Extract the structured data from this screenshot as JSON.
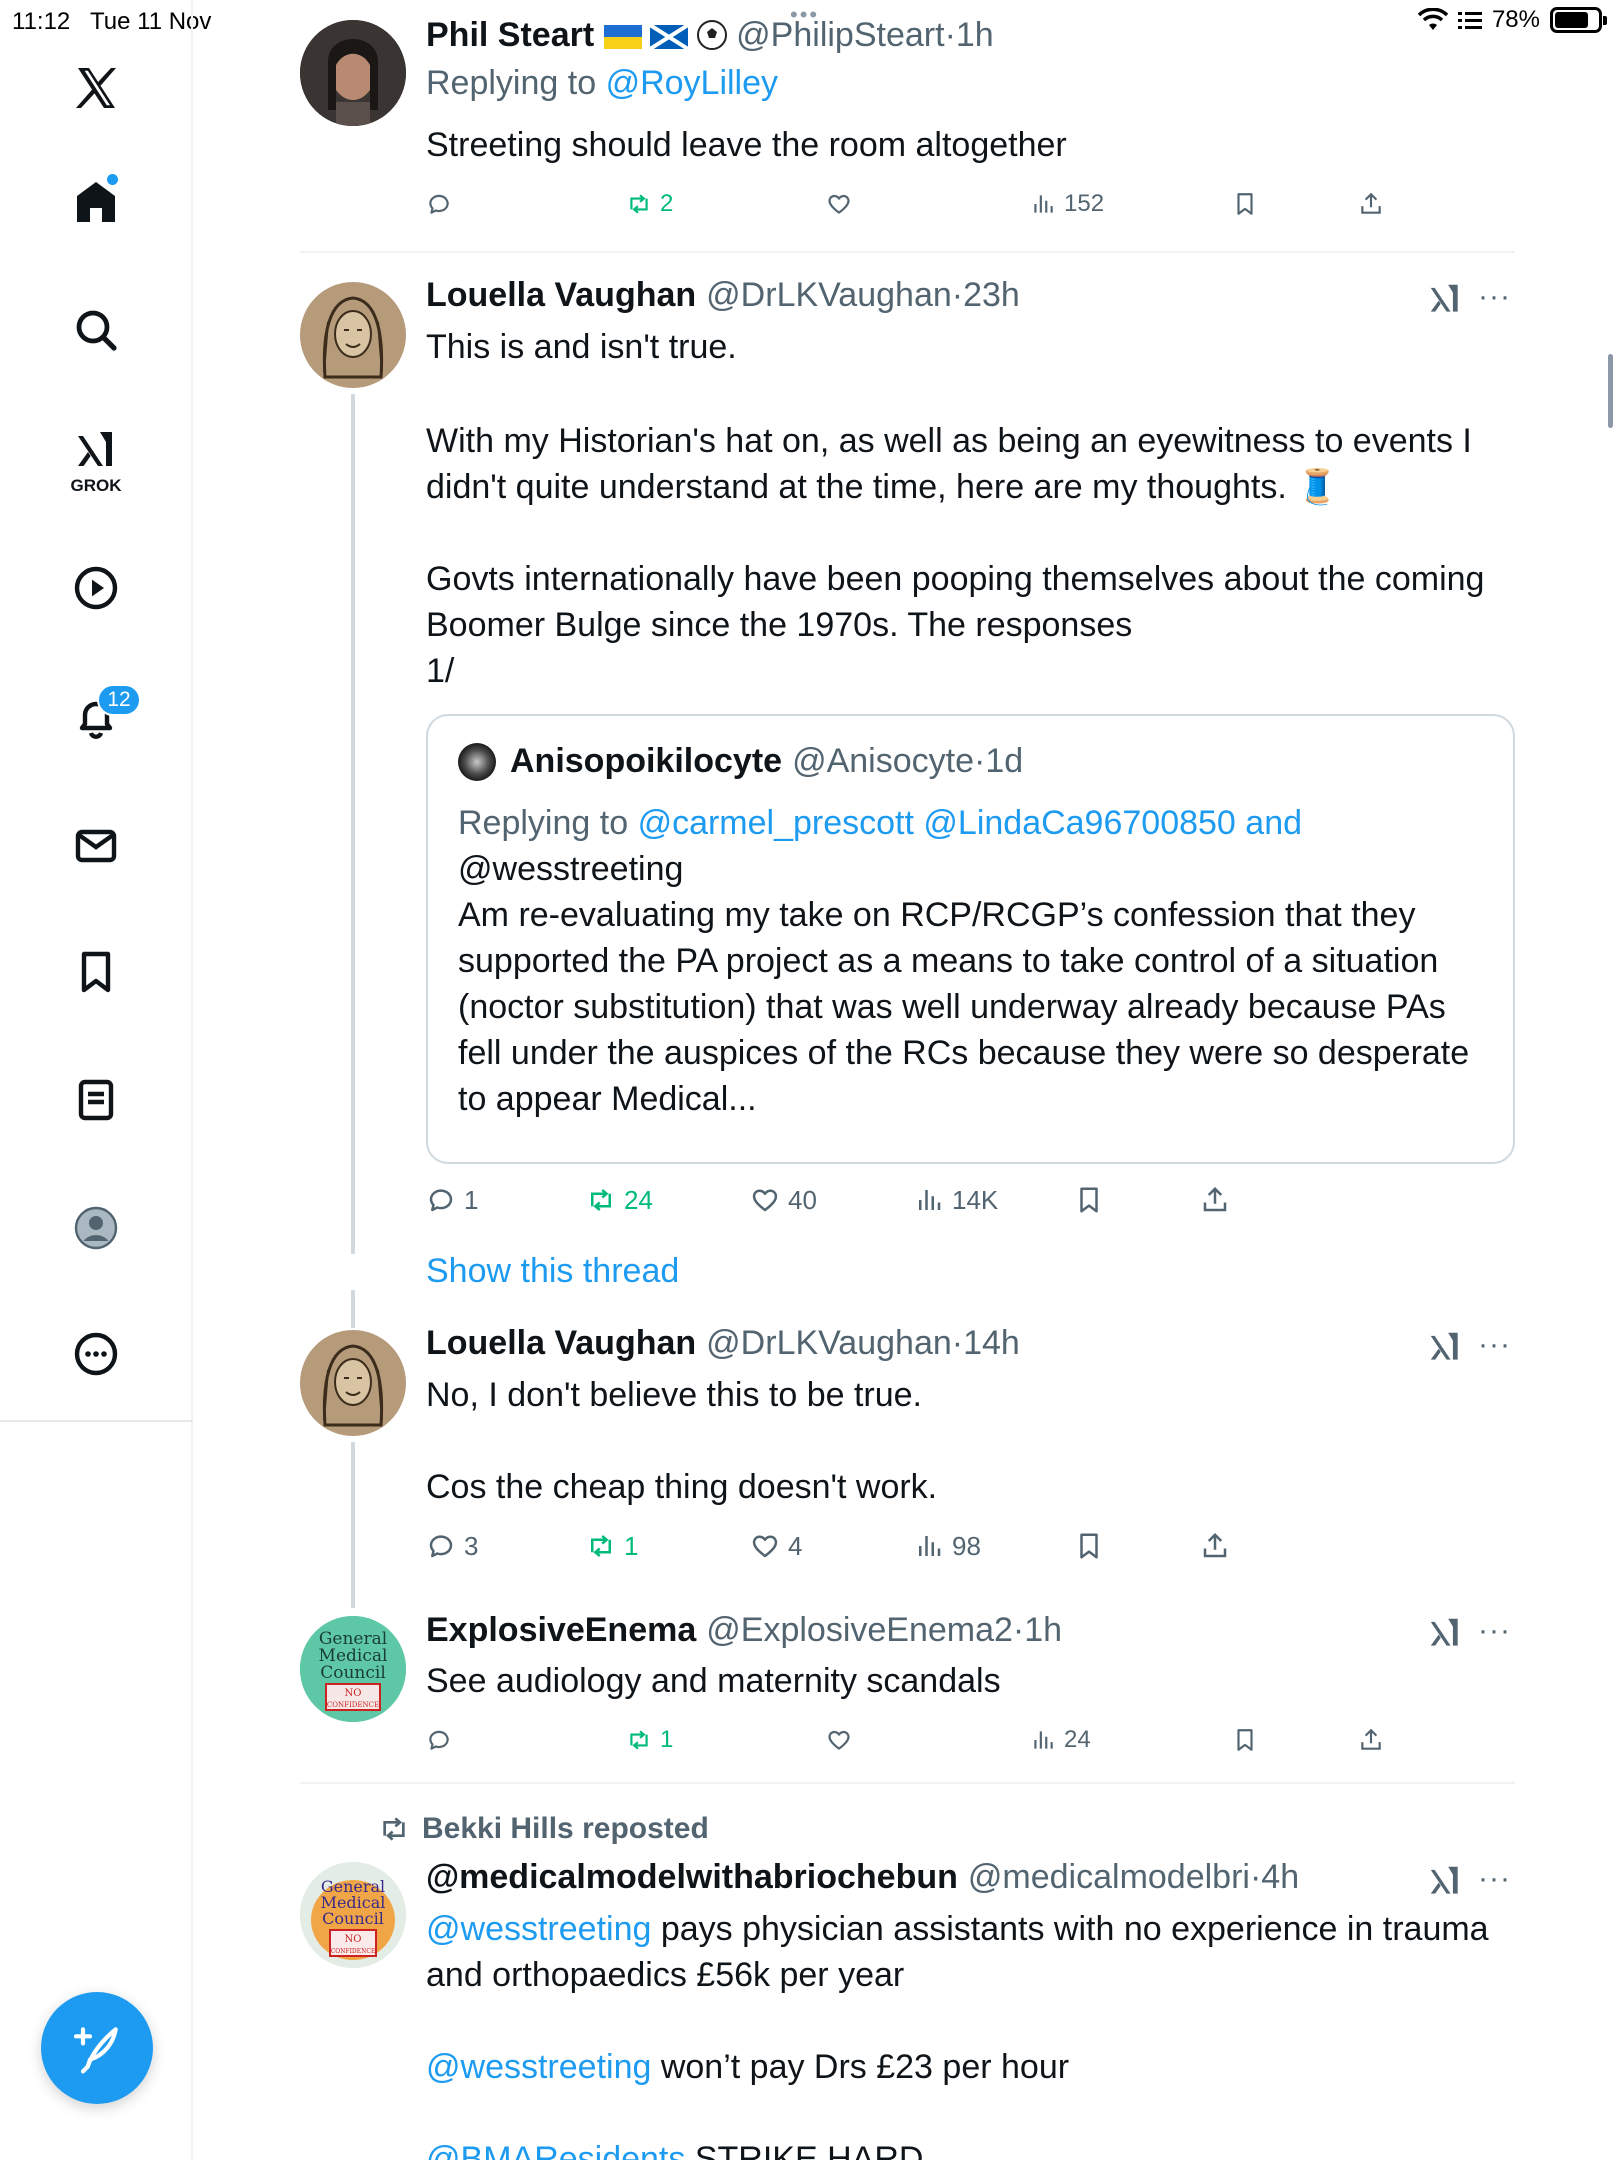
{
  "status_bar": {
    "time": "11:12",
    "date": "Tue 11 Nov",
    "battery": "78%",
    "battery_level": 0.78,
    "top_dots": "•••"
  },
  "sidebar": {
    "items": [
      {
        "name": "x-logo-icon"
      },
      {
        "name": "home-icon"
      },
      {
        "name": "search-icon"
      },
      {
        "name": "grok-icon",
        "label": "GROK"
      },
      {
        "name": "video-icon"
      },
      {
        "name": "notifications-icon",
        "badge": "12"
      },
      {
        "name": "messages-icon"
      },
      {
        "name": "bookmarks-icon"
      },
      {
        "name": "lists-icon"
      },
      {
        "name": "profile-icon"
      },
      {
        "name": "more-icon"
      }
    ],
    "compose": "compose-icon"
  },
  "tweets": [
    {
      "display_name": "Phil Steart",
      "handle": "@PhilipSteart",
      "time": "1h",
      "replying_prefix": "Replying to",
      "replying_to": "@RoyLilley",
      "text": "Streeting should leave the room altogether",
      "replies": "",
      "reposts": "2",
      "likes": "",
      "views": "152"
    },
    {
      "display_name": "Louella Vaughan",
      "handle": "@DrLKVaughan",
      "time": "23h",
      "text_lines": [
        "This is and isn't true.",
        "With my Historian's hat on, as well as being an eyewitness to events I",
        "didn't quite understand at the time, here are my thoughts. 🧵",
        "Govts internationally have been pooping themselves about the coming",
        "Boomer Bulge since the 1970s. The responses",
        "1/"
      ],
      "replies": "1",
      "reposts": "24",
      "likes": "40",
      "views": "14K",
      "quote": {
        "display_name": "Anisopoikilocyte",
        "handle": "@Anisocyte",
        "time": "1d",
        "replying_prefix": "Replying to",
        "replying_to": "@carmel_prescott @LindaCa96700850 and",
        "replying_to_2": "@wesstreeting",
        "text_lines": [
          "Am re-evaluating my take on RCP/RCGP’s confession that they",
          "supported the PA project as a means to take control of a situation",
          "(noctor substitution) that was well underway already because PAs",
          "fell under the auspices of the RCs because they were so desperate",
          "to appear Medical..."
        ]
      },
      "show_thread": "Show this thread"
    },
    {
      "display_name": "Louella Vaughan",
      "handle": "@DrLKVaughan",
      "time": "14h",
      "text_lines": [
        "No, I don't believe this to be true.",
        "Cos the cheap thing doesn't work."
      ],
      "replies": "3",
      "reposts": "1",
      "likes": "4",
      "views": "98"
    },
    {
      "display_name": "ExplosiveEnema",
      "handle": "@ExplosiveEnema2",
      "time": "1h",
      "text": "See audiology and maternity scandals",
      "replies": "",
      "reposts": "1",
      "likes": "",
      "views": "24",
      "avatar_text": [
        "General",
        "Medical",
        "Council",
        "NO",
        "CONFIDENCE"
      ]
    },
    {
      "repost_by": "Bekki Hills reposted",
      "display_name": "@medicalmodelwithabriochebun",
      "handle": "@medicalmodelbri",
      "time": "4h",
      "mention": "@wesstreeting",
      "line1_rest": " pays physician assistants with no experience in trauma",
      "line2": "and orthopaedics £56k per year",
      "line3_rest": " won’t pay Drs £23 per hour",
      "line4_mention": "@BMAResidents",
      "line4_rest": " STRIKE HARD",
      "avatar_text": [
        "General",
        "Medical",
        "Council",
        "NO",
        "CONFIDENCE"
      ]
    }
  ],
  "colors": {
    "accent": "#1d9bf0",
    "repost_green": "#00ba7c",
    "secondary_text": "#536471",
    "divider": "#eff3f4"
  }
}
